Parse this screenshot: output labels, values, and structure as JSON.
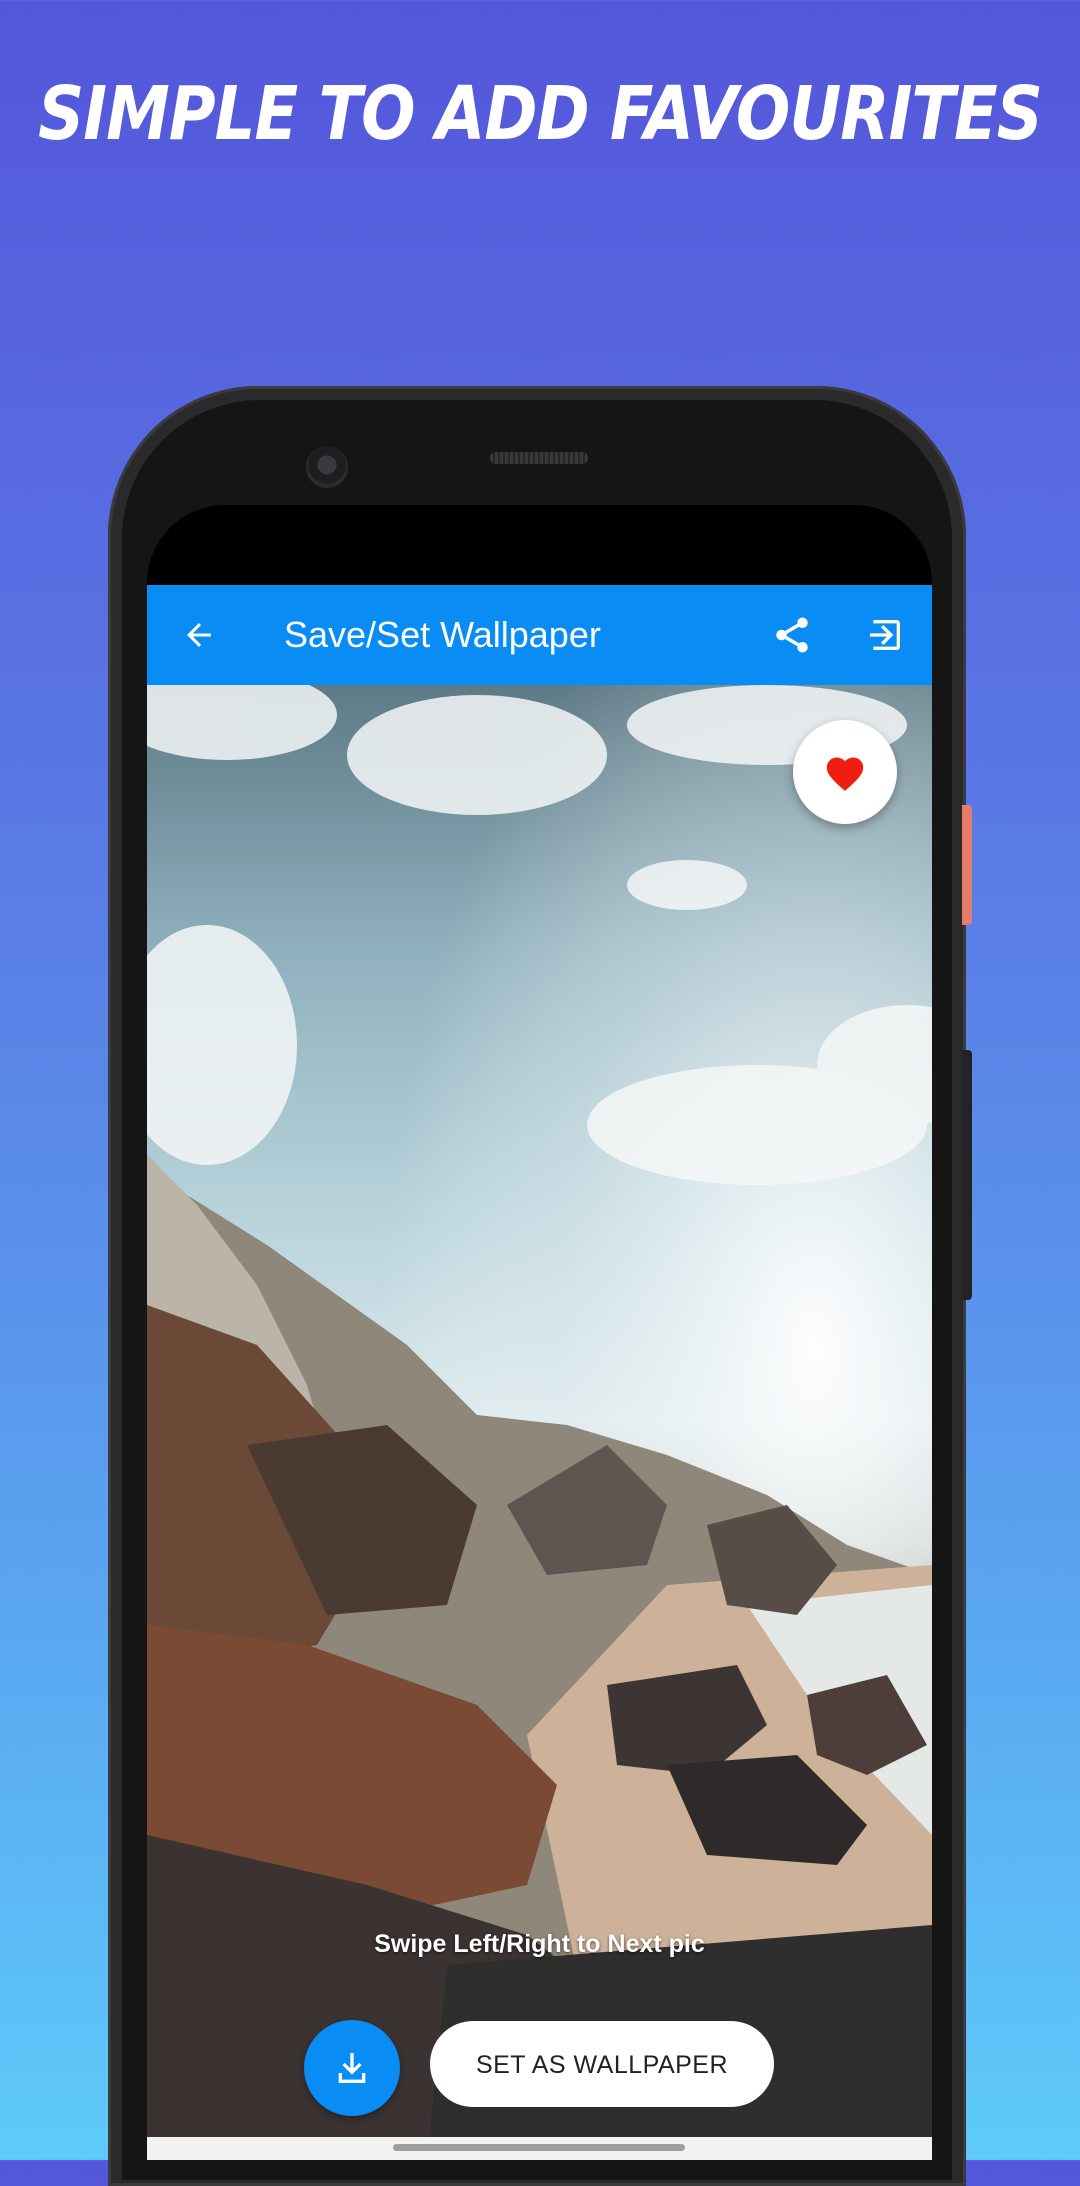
{
  "headline": "SIMPLE TO ADD FAVOURITES",
  "appbar": {
    "title": "Save/Set Wallpaper",
    "back_icon": "arrow-left-icon",
    "share_icon": "share-icon",
    "exit_icon": "exit-icon"
  },
  "favourite": {
    "icon": "heart-icon",
    "state": "favourited",
    "color": "#f01d10"
  },
  "hint_text": "Swipe Left/Right to Next pic",
  "actions": {
    "download_icon": "download-icon",
    "set_wallpaper_label": "SET AS WALLPAPER"
  },
  "colors": {
    "accent": "#0a8cf5",
    "background_top": "#5456da",
    "background_bottom": "#5ecbfa"
  }
}
